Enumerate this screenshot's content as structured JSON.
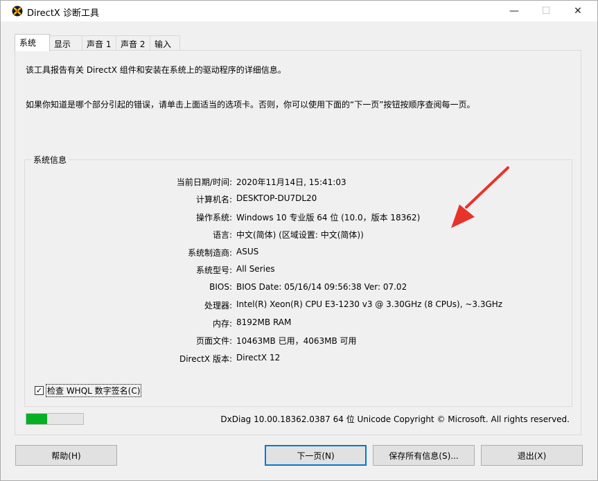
{
  "window": {
    "title": "DirectX 诊断工具",
    "minimize": "—",
    "maximize": "☐",
    "close": "✕"
  },
  "tabs": [
    {
      "label": "系统",
      "active": true
    },
    {
      "label": "显示"
    },
    {
      "label": "声音 1"
    },
    {
      "label": "声音 2"
    },
    {
      "label": "输入"
    }
  ],
  "intro": {
    "line1": "该工具报告有关 DirectX 组件和安装在系统上的驱动程序的详细信息。",
    "line2": "如果你知道是哪个部分引起的错误，请单击上面适当的选项卡。否则，你可以使用下面的“下一页”按钮按顺序查阅每一页。"
  },
  "system_info": {
    "title": "系统信息",
    "rows": [
      {
        "label": "当前日期/时间:",
        "value": "2020年11月14日, 15:41:03"
      },
      {
        "label": "计算机名:",
        "value": "DESKTOP-DU7DL20"
      },
      {
        "label": "操作系统:",
        "value": "Windows 10 专业版 64 位 (10.0，版本 18362)"
      },
      {
        "label": "语言:",
        "value": "中文(简体) (区域设置: 中文(简体))"
      },
      {
        "label": "系统制造商:",
        "value": "ASUS"
      },
      {
        "label": "系统型号:",
        "value": "All Series"
      },
      {
        "label": "BIOS:",
        "value": "BIOS Date: 05/16/14 09:56:38 Ver: 07.02"
      },
      {
        "label": "处理器:",
        "value": "Intel(R) Xeon(R) CPU E3-1230 v3 @ 3.30GHz (8 CPUs), ~3.3GHz"
      },
      {
        "label": "内存:",
        "value": "8192MB RAM"
      },
      {
        "label": "页面文件:",
        "value": "10463MB 已用，4063MB 可用"
      },
      {
        "label": "DirectX 版本:",
        "value": "DirectX 12"
      }
    ]
  },
  "whql_check": {
    "label": "检查 WHQL 数字签名(C)",
    "checked": true,
    "mark": "✓"
  },
  "progress": {
    "fraction": 0.37,
    "color": "#06b025"
  },
  "footer": "DxDiag 10.00.18362.0387 64 位 Unicode  Copyright © Microsoft. All rights reserved.",
  "buttons": {
    "help": "帮助(H)",
    "next": "下一页(N)",
    "save": "保存所有信息(S)...",
    "exit": "退出(X)"
  },
  "colors": {
    "accent": "#0078d7",
    "annotation_arrow": "#e8332a"
  },
  "icons": {
    "app": "directx-icon",
    "annotation": "red-arrow-icon"
  }
}
